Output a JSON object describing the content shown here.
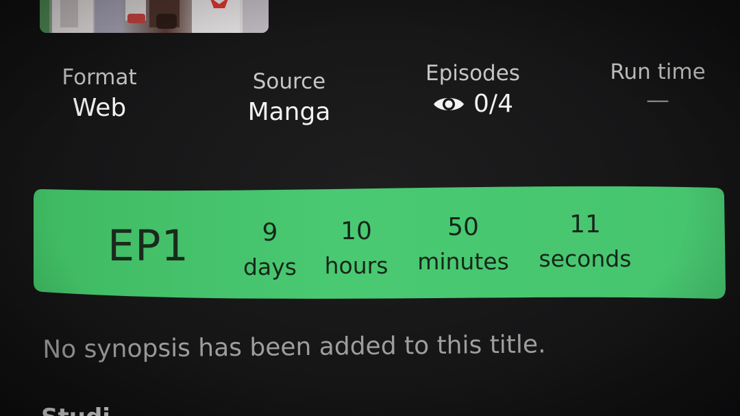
{
  "stats": {
    "format": {
      "label": "Format",
      "value": "Web"
    },
    "source": {
      "label": "Source",
      "value": "Manga"
    },
    "episodes": {
      "label": "Episodes",
      "value": "0/4",
      "icon": "eye-icon"
    },
    "run_time": {
      "label": "Run time",
      "value": "—"
    }
  },
  "countdown": {
    "episode": "EP1",
    "days": {
      "value": "9",
      "label": "days"
    },
    "hours": {
      "value": "10",
      "label": "hours"
    },
    "minutes": {
      "value": "50",
      "label": "minutes"
    },
    "seconds": {
      "value": "11",
      "label": "seconds"
    },
    "color": "#46c46e"
  },
  "synopsis": "No synopsis has been added to this title.",
  "next_section": "Studi"
}
